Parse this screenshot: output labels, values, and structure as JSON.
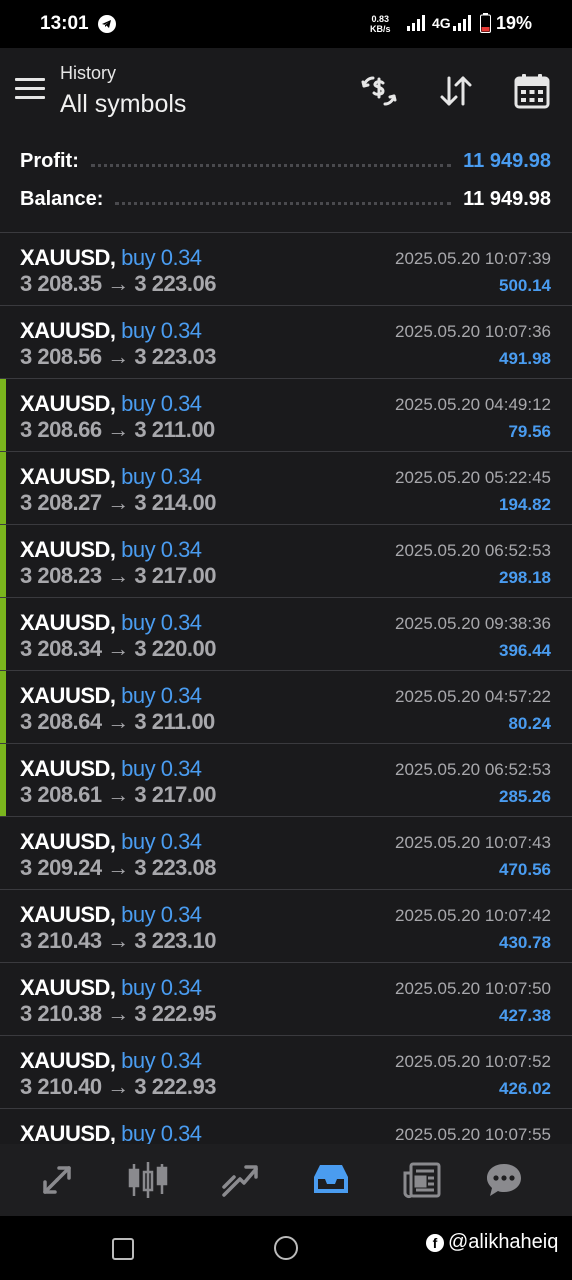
{
  "status_bar": {
    "time": "13:01",
    "speed_value": "0.83",
    "speed_unit": "KB/s",
    "network": "4G",
    "battery": "19%"
  },
  "header": {
    "subtitle": "History",
    "title": "All symbols",
    "icons": [
      "currency-exchange-icon",
      "sort-icon",
      "calendar-icon"
    ]
  },
  "summary": {
    "profit_label": "Profit:",
    "profit_value": "11 949.98",
    "balance_label": "Balance:",
    "balance_value": "11 949.98",
    "profit_color": "#4a9cf0",
    "balance_color": "#ffffff"
  },
  "trades": [
    {
      "symbol": "XAUUSD,",
      "side": "buy 0.34",
      "prices": "3 208.35 → 3 223.06",
      "time": "2025.05.20 10:07:39",
      "profit": "500.14",
      "marked": false
    },
    {
      "symbol": "XAUUSD,",
      "side": "buy 0.34",
      "prices": "3 208.56 → 3 223.03",
      "time": "2025.05.20 10:07:36",
      "profit": "491.98",
      "marked": false
    },
    {
      "symbol": "XAUUSD,",
      "side": "buy 0.34",
      "prices": "3 208.66 → 3 211.00",
      "time": "2025.05.20 04:49:12",
      "profit": "79.56",
      "marked": true
    },
    {
      "symbol": "XAUUSD,",
      "side": "buy 0.34",
      "prices": "3 208.27 → 3 214.00",
      "time": "2025.05.20 05:22:45",
      "profit": "194.82",
      "marked": true
    },
    {
      "symbol": "XAUUSD,",
      "side": "buy 0.34",
      "prices": "3 208.23 → 3 217.00",
      "time": "2025.05.20 06:52:53",
      "profit": "298.18",
      "marked": true
    },
    {
      "symbol": "XAUUSD,",
      "side": "buy 0.34",
      "prices": "3 208.34 → 3 220.00",
      "time": "2025.05.20 09:38:36",
      "profit": "396.44",
      "marked": true
    },
    {
      "symbol": "XAUUSD,",
      "side": "buy 0.34",
      "prices": "3 208.64 → 3 211.00",
      "time": "2025.05.20 04:57:22",
      "profit": "80.24",
      "marked": true
    },
    {
      "symbol": "XAUUSD,",
      "side": "buy 0.34",
      "prices": "3 208.61 → 3 217.00",
      "time": "2025.05.20 06:52:53",
      "profit": "285.26",
      "marked": true
    },
    {
      "symbol": "XAUUSD,",
      "side": "buy 0.34",
      "prices": "3 209.24 → 3 223.08",
      "time": "2025.05.20 10:07:43",
      "profit": "470.56",
      "marked": false
    },
    {
      "symbol": "XAUUSD,",
      "side": "buy 0.34",
      "prices": "3 210.43 → 3 223.10",
      "time": "2025.05.20 10:07:42",
      "profit": "430.78",
      "marked": false
    },
    {
      "symbol": "XAUUSD,",
      "side": "buy 0.34",
      "prices": "3 210.38 → 3 222.95",
      "time": "2025.05.20 10:07:50",
      "profit": "427.38",
      "marked": false
    },
    {
      "symbol": "XAUUSD,",
      "side": "buy 0.34",
      "prices": "3 210.40 → 3 222.93",
      "time": "2025.05.20 10:07:52",
      "profit": "426.02",
      "marked": false
    },
    {
      "symbol": "XAUUSD,",
      "side": "buy 0.34",
      "prices": "",
      "time": "2025.05.20 10:07:55",
      "profit": "",
      "marked": false
    }
  ],
  "bottom_nav": {
    "items": [
      "quotes-icon",
      "chart-icon",
      "trade-icon",
      "history-icon",
      "news-icon",
      "chat-icon"
    ],
    "active": "history-icon",
    "active_color": "#4a9cf0"
  },
  "watermark": {
    "text": "@alikhaheiq",
    "icon_letter": "f"
  }
}
